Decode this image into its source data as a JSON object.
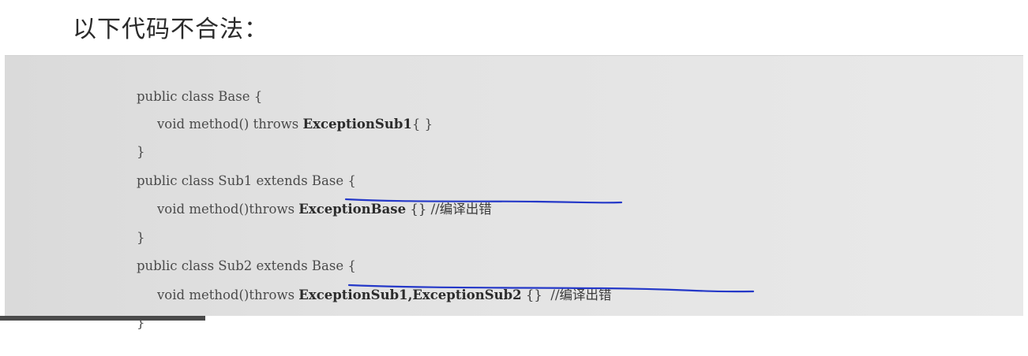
{
  "heading": "以下代码不合法：",
  "code": {
    "lines": [
      {
        "prefix": "public class Base {",
        "bold": "",
        "suffix": ""
      },
      {
        "prefix": "void method() throws ",
        "bold": "ExceptionSub1",
        "suffix": "{ }"
      },
      {
        "prefix": "}",
        "bold": "",
        "suffix": ""
      },
      {
        "prefix": "public class Sub1 extends Base {",
        "bold": "",
        "suffix": ""
      },
      {
        "prefix": "void method()throws ",
        "bold": "ExceptionBase",
        "suffix": " {} //编译出错"
      },
      {
        "prefix": "}",
        "bold": "",
        "suffix": ""
      },
      {
        "prefix": "public class Sub2 extends Base {",
        "bold": "",
        "suffix": ""
      },
      {
        "prefix": "void method()throws ",
        "bold": "ExceptionSub1,ExceptionSub2",
        "suffix": " {}  //编译出错"
      },
      {
        "prefix": "}",
        "bold": "",
        "suffix": ""
      }
    ]
  },
  "colors": {
    "underline": "#2438c8",
    "code_bg": "#e2e2e2"
  }
}
